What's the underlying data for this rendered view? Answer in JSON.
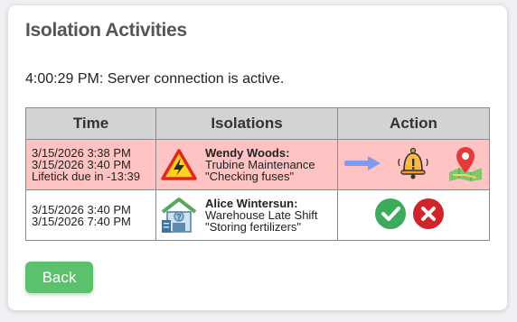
{
  "page": {
    "title": "Isolation Activities"
  },
  "status": {
    "text": "4:00:29 PM: Server connection is active."
  },
  "table": {
    "headers": {
      "time": "Time",
      "isolations": "Isolations",
      "action": "Action"
    },
    "rows": [
      {
        "state": "alarm",
        "times": [
          "3/15/2026 3:38 PM",
          "3/15/2026 3:40 PM",
          "Lifetick due in -13:39"
        ],
        "icon": "electrical-warning-icon",
        "name": "Wendy Woods:",
        "activity": "Trubine Maintenance",
        "note": "\"Checking fuses\"",
        "actions": [
          "arrow-right-icon",
          "alarm-bell-icon",
          "map-location-icon"
        ]
      },
      {
        "state": "normal",
        "times": [
          "3/15/2026 3:40 PM",
          "3/15/2026 7:40 PM"
        ],
        "icon": "warehouse-icon",
        "name": "Alice Wintersun:",
        "activity": "Warehouse Late Shift",
        "note": "\"Storing fertilizers\"",
        "actions": [
          "confirm-check-icon",
          "cancel-x-icon"
        ]
      }
    ]
  },
  "back_button": {
    "label": "Back"
  },
  "colors": {
    "alarm_row": "#ffc3c3",
    "header_bg": "#d3d3d3",
    "back_button": "#5cc16c",
    "confirm": "#3daa5c",
    "cancel": "#d0232a"
  }
}
